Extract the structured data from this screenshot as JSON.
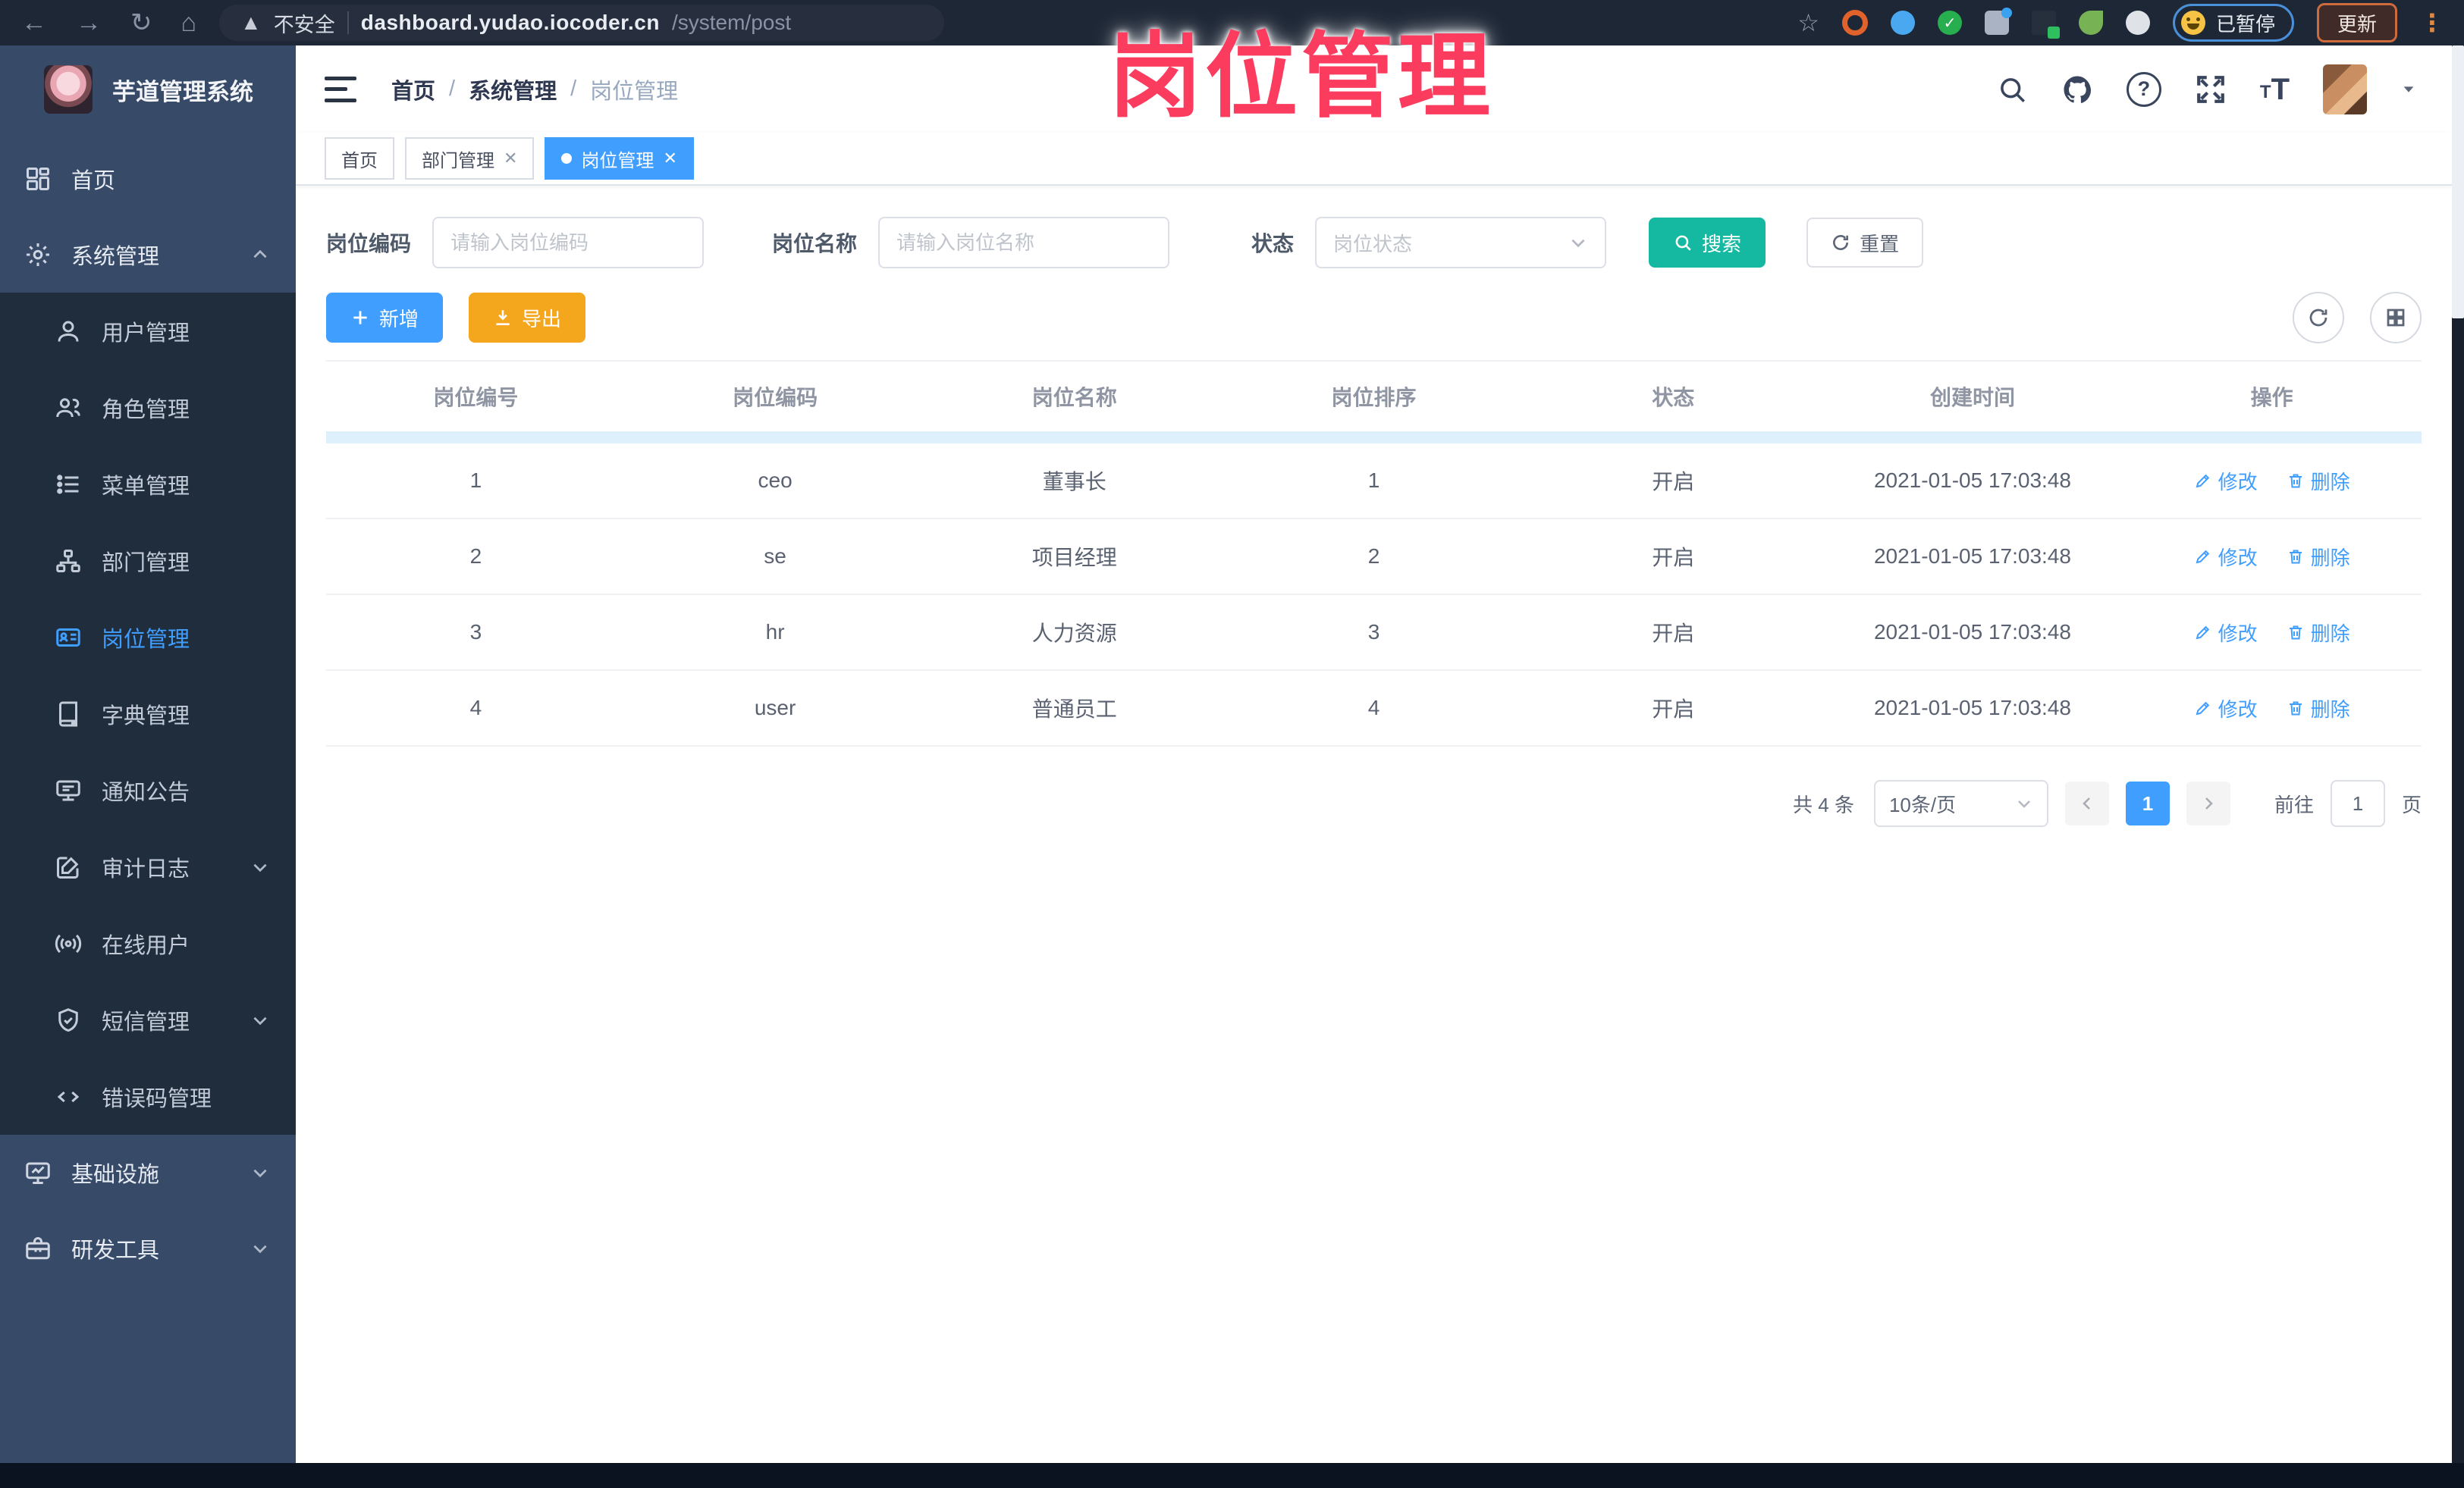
{
  "watermark_text": "岗位管理",
  "colors": {
    "accent": "#409eff",
    "search_teal": "#15b8a0",
    "export_orange": "#f4a61d",
    "watermark_pink": "#fb3c5f",
    "sidebar_bg": "#374a68",
    "submenu_bg": "#1f2d3d"
  },
  "browser": {
    "security_label": "不安全",
    "url_host": "dashboard.yudao.iocoder.cn",
    "url_path": "/system/post",
    "paused_label": "已暂停",
    "update_label": "更新"
  },
  "sidebar": {
    "app_title": "芋道管理系统",
    "items": [
      {
        "label": "首页"
      },
      {
        "label": "系统管理"
      },
      {
        "label": "用户管理"
      },
      {
        "label": "角色管理"
      },
      {
        "label": "菜单管理"
      },
      {
        "label": "部门管理"
      },
      {
        "label": "岗位管理"
      },
      {
        "label": "字典管理"
      },
      {
        "label": "通知公告"
      },
      {
        "label": "审计日志"
      },
      {
        "label": "在线用户"
      },
      {
        "label": "短信管理"
      },
      {
        "label": "错误码管理"
      },
      {
        "label": "基础设施"
      },
      {
        "label": "研发工具"
      }
    ]
  },
  "header": {
    "breadcrumbs": {
      "home": "首页",
      "section": "系统管理",
      "current": "岗位管理"
    }
  },
  "tabs": {
    "t0": "首页",
    "t1": "部门管理",
    "t2": "岗位管理"
  },
  "filters": {
    "post_code_label": "岗位编码",
    "post_code_placeholder": "请输入岗位编码",
    "post_name_label": "岗位名称",
    "post_name_placeholder": "请输入岗位名称",
    "status_label": "状态",
    "status_placeholder": "岗位状态",
    "search_label": "搜索",
    "reset_label": "重置"
  },
  "actions": {
    "add": "新增",
    "export": "导出"
  },
  "table": {
    "columns": [
      "岗位编号",
      "岗位编码",
      "岗位名称",
      "岗位排序",
      "状态",
      "创建时间",
      "操作"
    ],
    "rows": [
      {
        "id": "1",
        "code": "ceo",
        "name": "董事长",
        "sort": "1",
        "status": "开启",
        "created": "2021-01-05 17:03:48"
      },
      {
        "id": "2",
        "code": "se",
        "name": "项目经理",
        "sort": "2",
        "status": "开启",
        "created": "2021-01-05 17:03:48"
      },
      {
        "id": "3",
        "code": "hr",
        "name": "人力资源",
        "sort": "3",
        "status": "开启",
        "created": "2021-01-05 17:03:48"
      },
      {
        "id": "4",
        "code": "user",
        "name": "普通员工",
        "sort": "4",
        "status": "开启",
        "created": "2021-01-05 17:03:48"
      }
    ],
    "ops": {
      "edit": "修改",
      "delete": "删除"
    }
  },
  "pagination": {
    "total": "共 4 条",
    "page_size": "10条/页",
    "current_page": "1",
    "goto_label": "前往",
    "goto_value": "1",
    "page_unit": "页"
  }
}
